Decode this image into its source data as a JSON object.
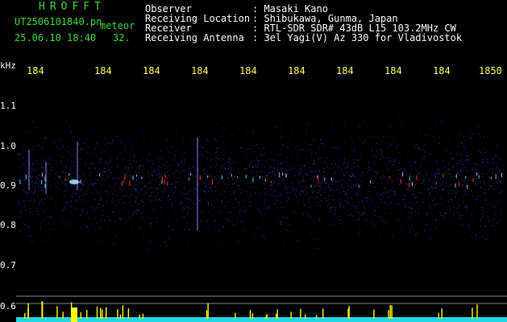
{
  "header": {
    "brand": "HROFFT",
    "filename": "UT2506101840.pn",
    "filename_suffix": "meteor",
    "datetime": "25.06.10 18:40",
    "count": "32.",
    "labels": [
      "Observer",
      "Receiving Location",
      "Receiver",
      "Receiving Antenna"
    ],
    "values": [
      ": Masaki Kano",
      ": Shibukawa, Gunma, Japan",
      ": RTL-SDR SDR# 43dB L15 103.2MHz CW",
      ": 3el Yagi(V) Az 330 for Vladivostok"
    ]
  },
  "axes": {
    "freq_unit": "kHz",
    "time_ticks": [
      "184",
      "184",
      "184",
      "184",
      "184",
      "184",
      "184",
      "184",
      "184",
      "1850"
    ],
    "freq_ticks": [
      "1.1",
      "1.0",
      "0.9",
      "0.8",
      "0.7",
      "0.6"
    ]
  },
  "colors": {
    "background": "#000000",
    "label_text": "#ffffff",
    "brand_text": "#3ddc3d",
    "tick_text": "#ffff66",
    "noise": "#2a2ad0",
    "signal_hot": "#ff3030",
    "peak_bars": "#ffff00",
    "baseline": "#22d8e8"
  }
}
